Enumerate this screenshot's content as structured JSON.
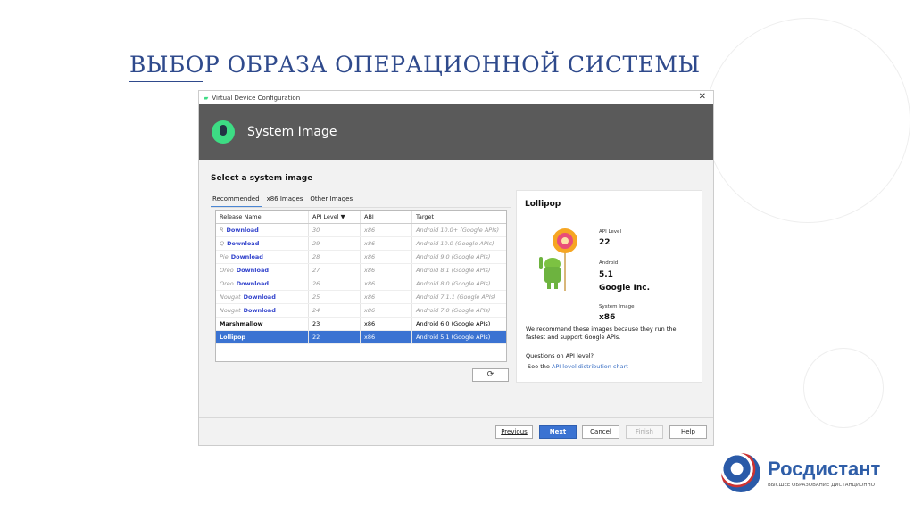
{
  "slide_title": "ВЫБОР ОБРАЗА ОПЕРАЦИОННОЙ СИСТЕМЫ",
  "dialog": {
    "window_title": "Virtual Device Configuration",
    "close": "✕",
    "header": "System Image",
    "heading": "Select a system image",
    "tabs": [
      "Recommended",
      "x86 Images",
      "Other Images"
    ],
    "columns": [
      "Release Name",
      "API Level ▼",
      "ABI",
      "Target"
    ],
    "rows": [
      {
        "name": "R",
        "link": "Download",
        "api": "30",
        "abi": "x86",
        "target": "Android 10.0+ (Google APIs)"
      },
      {
        "name": "Q",
        "link": "Download",
        "api": "29",
        "abi": "x86",
        "target": "Android 10.0 (Google APIs)"
      },
      {
        "name": "Pie",
        "link": "Download",
        "api": "28",
        "abi": "x86",
        "target": "Android 9.0 (Google APIs)"
      },
      {
        "name": "Oreo",
        "link": "Download",
        "api": "27",
        "abi": "x86",
        "target": "Android 8.1 (Google APIs)"
      },
      {
        "name": "Oreo",
        "link": "Download",
        "api": "26",
        "abi": "x86",
        "target": "Android 8.0 (Google APIs)"
      },
      {
        "name": "Nougat",
        "link": "Download",
        "api": "25",
        "abi": "x86",
        "target": "Android 7.1.1 (Google APIs)"
      },
      {
        "name": "Nougat",
        "link": "Download",
        "api": "24",
        "abi": "x86",
        "target": "Android 7.0 (Google APIs)"
      },
      {
        "name": "Marshmallow",
        "api": "23",
        "abi": "x86",
        "target": "Android 6.0 (Google APIs)"
      },
      {
        "name": "Lollipop",
        "api": "22",
        "abi": "x86",
        "target": "Android 5.1 (Google APIs)"
      }
    ],
    "refresh": "⟳",
    "panel": {
      "title": "Lollipop",
      "api_label": "API Level",
      "api_value": "22",
      "android_label": "Android",
      "android_value": "5.1",
      "vendor": "Google Inc.",
      "image_label": "System Image",
      "image_value": "x86",
      "recommend": "We recommend these images because they run the fastest and support Google APIs.",
      "question": "Questions on API level?",
      "see": "See the ",
      "link": "API level distribution chart"
    },
    "buttons": {
      "previous": "Previous",
      "next": "Next",
      "cancel": "Cancel",
      "finish": "Finish",
      "help": "Help"
    }
  },
  "brand": {
    "name": "Росдистант",
    "tagline": "ВЫСШЕЕ ОБРАЗОВАНИЕ ДИСТАНЦИОННО"
  }
}
